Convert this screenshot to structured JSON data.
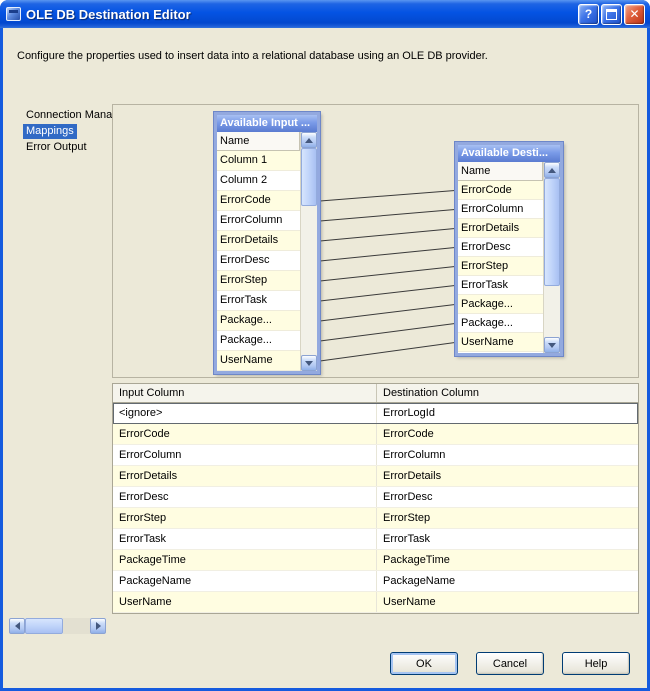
{
  "window": {
    "title": "OLE DB Destination Editor",
    "controls": {
      "help_glyph": "?",
      "close_glyph": "✕"
    }
  },
  "description": "Configure the properties used to insert data into a relational database using an OLE DB provider.",
  "sidebar": {
    "items": [
      {
        "label": "Connection Manager",
        "selected": false
      },
      {
        "label": "Mappings",
        "selected": true
      },
      {
        "label": "Error Output",
        "selected": false
      }
    ]
  },
  "input_box": {
    "title": "Available Input ...",
    "header": "Name",
    "items": [
      "Column 1",
      "Column 2",
      "ErrorCode",
      "ErrorColumn",
      "ErrorDetails",
      "ErrorDesc",
      "ErrorStep",
      "ErrorTask",
      "Package...",
      "Package...",
      "UserName"
    ]
  },
  "dest_box": {
    "title": "Available Desti...",
    "header": "Name",
    "items": [
      "ErrorCode",
      "ErrorColumn",
      "ErrorDetails",
      "ErrorDesc",
      "ErrorStep",
      "ErrorTask",
      "Package...",
      "Package...",
      "UserName"
    ]
  },
  "connections": [
    [
      2,
      0
    ],
    [
      3,
      1
    ],
    [
      4,
      2
    ],
    [
      5,
      3
    ],
    [
      6,
      4
    ],
    [
      7,
      5
    ],
    [
      8,
      6
    ],
    [
      9,
      7
    ],
    [
      10,
      8
    ]
  ],
  "table": {
    "columns": [
      "Input Column",
      "Destination Column"
    ],
    "rows": [
      [
        "<ignore>",
        "ErrorLogId"
      ],
      [
        "ErrorCode",
        "ErrorCode"
      ],
      [
        "ErrorColumn",
        "ErrorColumn"
      ],
      [
        "ErrorDetails",
        "ErrorDetails"
      ],
      [
        "ErrorDesc",
        "ErrorDesc"
      ],
      [
        "ErrorStep",
        "ErrorStep"
      ],
      [
        "ErrorTask",
        "ErrorTask"
      ],
      [
        "PackageTime",
        "PackageTime"
      ],
      [
        "PackageName",
        "PackageName"
      ],
      [
        "UserName",
        "UserName"
      ]
    ]
  },
  "footer": {
    "ok_label": "OK",
    "cancel_label": "Cancel",
    "help_label": "Help"
  },
  "colors": {
    "titlebar_blue": "#0353E0",
    "selection_blue": "#316AC5",
    "row_alt_yellow": "#FFFDE1",
    "box_frame_blue": "#93A9DF",
    "close_red": "#D8552F",
    "dialog_bg": "#ECE9D8"
  }
}
